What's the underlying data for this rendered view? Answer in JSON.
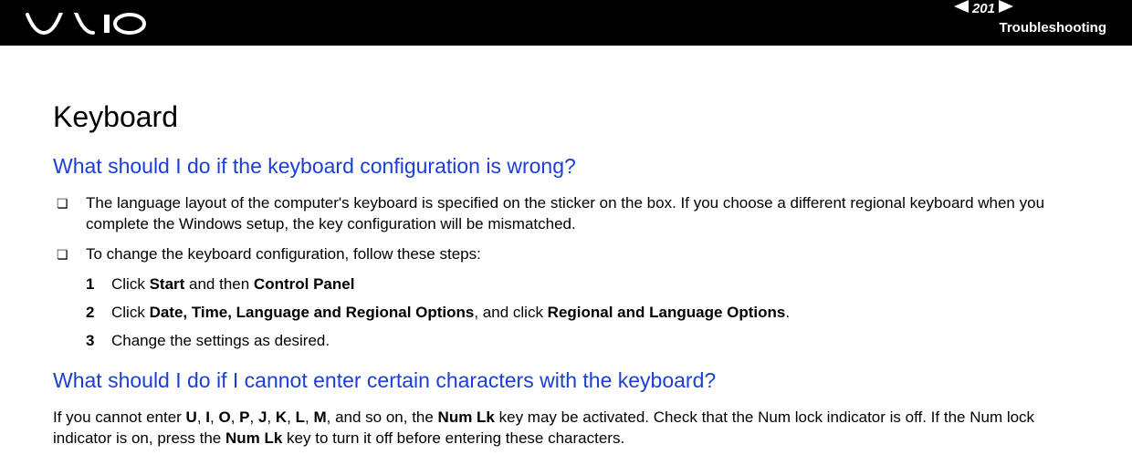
{
  "header": {
    "page_number": "201",
    "section": "Troubleshooting"
  },
  "content": {
    "title": "Keyboard",
    "q1": {
      "heading": "What should I do if the keyboard configuration is wrong?",
      "bullet1": "The language layout of the computer's keyboard is specified on the sticker on the box. If you choose a different regional keyboard when you complete the Windows setup, the key configuration will be mismatched.",
      "bullet2": "To change the keyboard configuration, follow these steps:",
      "steps": {
        "n1": "1",
        "t1_a": "Click ",
        "t1_b": "Start",
        "t1_c": " and then ",
        "t1_d": "Control Panel",
        "n2": "2",
        "t2_a": "Click ",
        "t2_b": "Date, Time, Language and Regional Options",
        "t2_c": ", and click ",
        "t2_d": "Regional and Language Options",
        "t2_e": ".",
        "n3": "3",
        "t3": "Change the settings as desired."
      }
    },
    "q2": {
      "heading": "What should I do if I cannot enter certain characters with the keyboard?",
      "p_a": "If you cannot enter ",
      "p_chars": [
        "U",
        "I",
        "O",
        "P",
        "J",
        "K",
        "L",
        "M"
      ],
      "p_b": ", and so on, the ",
      "p_c": "Num Lk",
      "p_d": " key may be activated. Check that the Num lock indicator is off. If the Num lock indicator is on, press the ",
      "p_e": "Num Lk",
      "p_f": " key to turn it off before entering these characters."
    }
  },
  "glyphs": {
    "bullet": "❏",
    "sep": ", "
  }
}
